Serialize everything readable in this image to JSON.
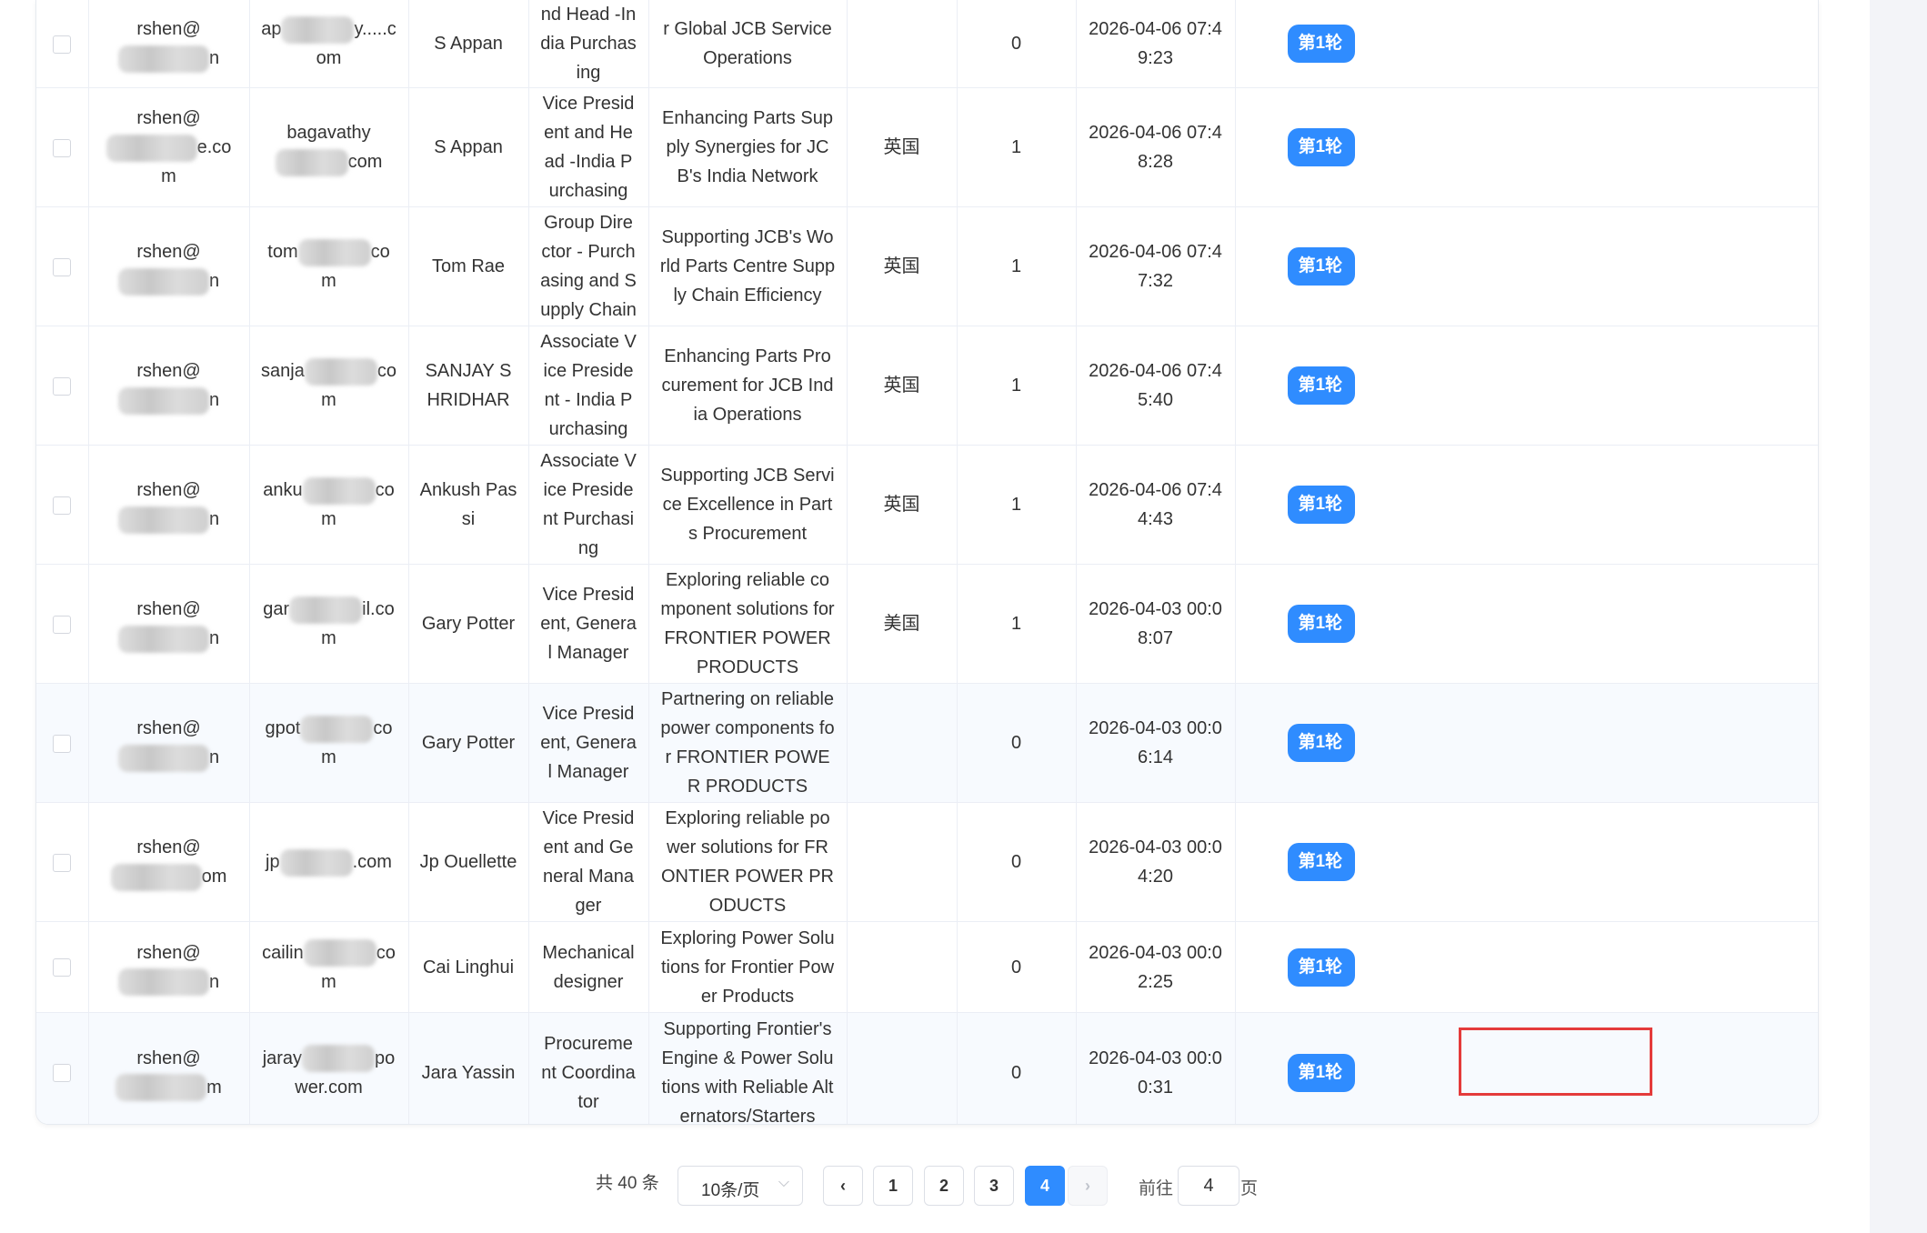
{
  "rows": [
    {
      "sender_prefix": "rshen@",
      "sender_suffix": "n",
      "recipient_prefix": "ap",
      "recipient_suffix": "y.....com",
      "name": "S Appan",
      "title": "nd Head -India Purchasing",
      "subject": "r Global JCB Service Operations",
      "country": "",
      "count": "0",
      "time": "2026-04-06 07:49:23",
      "round": "第1轮"
    },
    {
      "sender_prefix": "rshen@",
      "sender_suffix": "e.com",
      "recipient_prefix": "bagavathy",
      "recipient_suffix": "com",
      "name": "S Appan",
      "title": "Vice President and Head -India Purchasing",
      "subject": "Enhancing Parts Supply Synergies for JCB's India Network",
      "country": "英国",
      "count": "1",
      "time": "2026-04-06 07:48:28",
      "round": "第1轮"
    },
    {
      "sender_prefix": "rshen@",
      "sender_suffix": "n",
      "recipient_prefix": "tom",
      "recipient_suffix": "com",
      "name": "Tom Rae",
      "title": "Group Director - Purchasing and Supply Chain",
      "subject": "Supporting JCB's World Parts Centre Supply Chain Efficiency",
      "country": "英国",
      "count": "1",
      "time": "2026-04-06 07:47:32",
      "round": "第1轮"
    },
    {
      "sender_prefix": "rshen@",
      "sender_suffix": "n",
      "recipient_prefix": "sanja",
      "recipient_suffix": "com",
      "name": "SANJAY SHRIDHAR",
      "title": "Associate Vice President - India Purchasing",
      "subject": "Enhancing Parts Procurement for JCB India Operations",
      "country": "英国",
      "count": "1",
      "time": "2026-04-06 07:45:40",
      "round": "第1轮"
    },
    {
      "sender_prefix": "rshen@",
      "sender_suffix": "n",
      "recipient_prefix": "anku",
      "recipient_suffix": "com",
      "name": "Ankush Passi",
      "title": "Associate Vice President Purchasing",
      "subject": "Supporting JCB Service Excellence in Parts Procurement",
      "country": "英国",
      "count": "1",
      "time": "2026-04-06 07:44:43",
      "round": "第1轮"
    },
    {
      "sender_prefix": "rshen@",
      "sender_suffix": "n",
      "recipient_prefix": "gar",
      "recipient_suffix": "il.com",
      "name": "Gary Potter",
      "title": "Vice President, General Manager",
      "subject": "Exploring reliable component solutions for FRONTIER POWER PRODUCTS",
      "country": "美国",
      "count": "1",
      "time": "2026-04-03 00:08:07",
      "round": "第1轮"
    },
    {
      "sender_prefix": "rshen@",
      "sender_suffix": "n",
      "recipient_prefix": "gpot",
      "recipient_suffix": "com",
      "name": "Gary Potter",
      "title": "Vice President, General Manager",
      "subject": "Partnering on reliable power components for FRONTIER POWER PRODUCTS",
      "country": "",
      "count": "0",
      "time": "2026-04-03 00:06:14",
      "round": "第1轮"
    },
    {
      "sender_prefix": "rshen@",
      "sender_suffix": "om",
      "recipient_prefix": "jp",
      "recipient_suffix": ".com",
      "name": "Jp Ouellette",
      "title": "Vice President and General Manager",
      "subject": "Exploring reliable power solutions for FRONTIER POWER PRODUCTS",
      "country": "",
      "count": "0",
      "time": "2026-04-03 00:04:20",
      "round": "第1轮"
    },
    {
      "sender_prefix": "rshen@",
      "sender_suffix": "n",
      "recipient_prefix": "cailin",
      "recipient_suffix": "com",
      "name": "Cai Linghui",
      "title": "Mechanical designer",
      "subject": "Exploring Power Solutions for Frontier Power Products",
      "country": "",
      "count": "0",
      "time": "2026-04-03 00:02:25",
      "round": "第1轮"
    },
    {
      "sender_prefix": "rshen@",
      "sender_suffix": "m",
      "recipient_prefix": "jaray",
      "recipient_suffix": "power.com",
      "name": "Jara Yassin",
      "title": "Procurement Coordinator",
      "subject": "Supporting Frontier's Engine & Power Solutions with Reliable Alternators/Starters",
      "country": "",
      "count": "0",
      "time": "2026-04-03 00:00:31",
      "round": "第1轮"
    }
  ],
  "pagination": {
    "total_label": "共 40 条",
    "page_size_label": "10条/页",
    "prev_icon": "chevron-left-icon",
    "next_icon": "chevron-right-icon",
    "prev_glyph": "‹",
    "next_glyph": "›",
    "dropdown_glyph": "⌵",
    "pages": [
      "1",
      "2",
      "3",
      "4"
    ],
    "current_page": "4",
    "goto_label": "前往",
    "goto_value": "4",
    "page_suffix": "页"
  },
  "colors": {
    "accent": "#2f8cff",
    "highlight_border": "#e43b3b",
    "row_shade": "#f7fafe",
    "side_strip": "#f3f4f8"
  }
}
